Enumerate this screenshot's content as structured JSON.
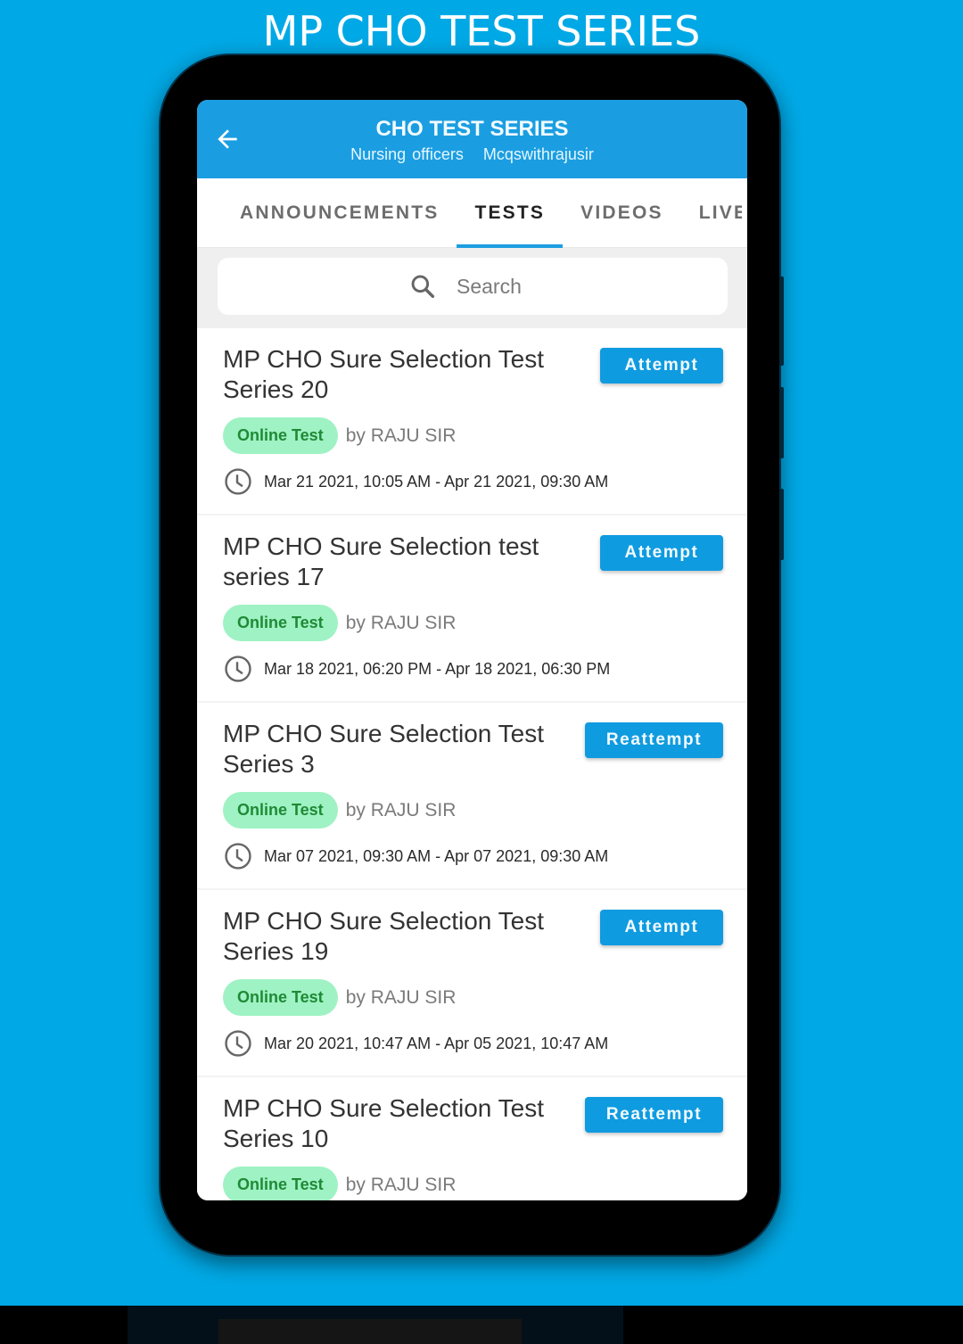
{
  "promo": {
    "title": "MP CHO TEST SERIES"
  },
  "colors": {
    "background": "#00a9e6",
    "appbar": "#1b9ee1",
    "button": "#0f9be0",
    "badge_bg": "#9ff2c3",
    "badge_text": "#1f8a36"
  },
  "appbar": {
    "back_icon": "arrow-left",
    "title": "CHO TEST SERIES",
    "subtitle_left": "Nursing officers",
    "subtitle_right": "Mcqswithrajusir"
  },
  "tabs": [
    {
      "label": "ANNOUNCEMENTS",
      "active": false
    },
    {
      "label": "TESTS",
      "active": true
    },
    {
      "label": "VIDEOS",
      "active": false
    },
    {
      "label": "LIVE",
      "active": false
    }
  ],
  "search": {
    "icon": "magnifier",
    "placeholder": "Search",
    "value": ""
  },
  "tests": [
    {
      "title": "MP CHO Sure Selection Test Series 20",
      "action": "Attempt",
      "badge": "Online Test",
      "author": "by RAJU SIR",
      "time": "Mar 21 2021, 10:05 AM - Apr 21 2021, 09:30 AM"
    },
    {
      "title": "MP CHO Sure Selection test series 17",
      "action": "Attempt",
      "badge": "Online Test",
      "author": "by RAJU SIR",
      "time": "Mar 18 2021, 06:20 PM - Apr 18 2021, 06:30 PM"
    },
    {
      "title": "MP CHO Sure Selection Test Series 3",
      "action": "Reattempt",
      "badge": "Online Test",
      "author": "by RAJU SIR",
      "time": "Mar 07 2021, 09:30 AM - Apr 07 2021, 09:30 AM"
    },
    {
      "title": "MP CHO Sure Selection Test Series 19",
      "action": "Attempt",
      "badge": "Online Test",
      "author": "by RAJU SIR",
      "time": "Mar 20 2021, 10:47 AM - Apr 05 2021, 10:47 AM"
    },
    {
      "title": "MP CHO Sure Selection Test Series 10",
      "action": "Reattempt",
      "badge": "Online Test",
      "author": "by RAJU SIR",
      "time": ""
    }
  ]
}
